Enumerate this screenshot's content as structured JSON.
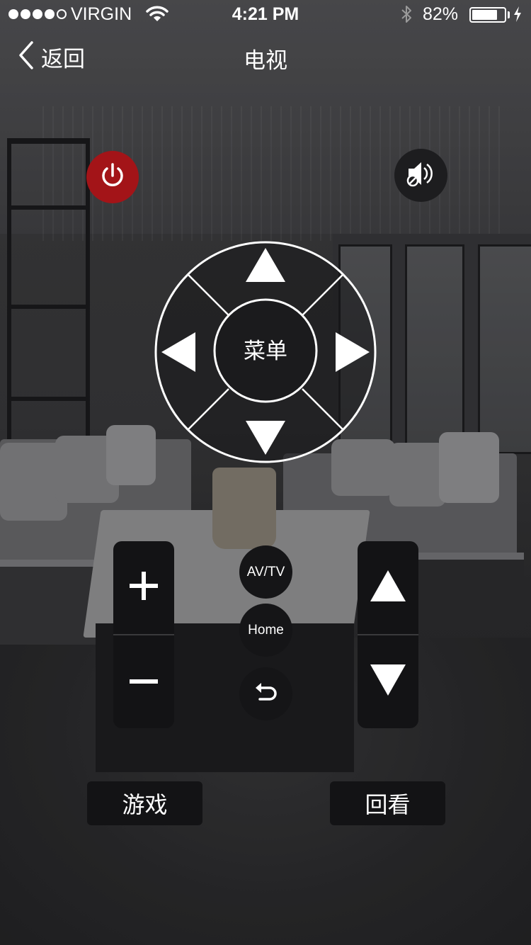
{
  "status_bar": {
    "carrier": "VIRGIN",
    "signal_bars_filled": 4,
    "signal_bars_total": 5,
    "time": "4:21 PM",
    "battery_percent_label": "82%",
    "battery_level": 0.82
  },
  "nav": {
    "back_label": "返回",
    "title": "电视"
  },
  "icons": {
    "power": "power-icon",
    "mute": "speaker-mute-icon",
    "back": "chevron-left-icon",
    "return": "return-arrow-icon"
  },
  "dpad": {
    "center_label": "菜单"
  },
  "controls": {
    "volume_up": "+",
    "volume_down": "−",
    "avtv_label": "AV/TV",
    "home_label": "Home"
  },
  "buttons": {
    "game_label": "游戏",
    "replay_label": "回看"
  },
  "colors": {
    "power_red": "#a31418",
    "button_dark": "#131315"
  }
}
